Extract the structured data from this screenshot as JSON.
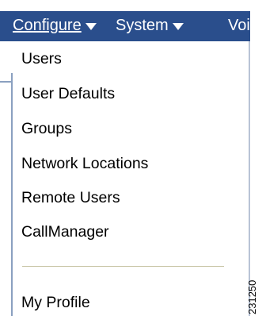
{
  "menubar": {
    "configure": "Configure",
    "system": "System",
    "voice": "Voi"
  },
  "configure_menu": {
    "items": [
      "Users",
      "User Defaults",
      "Groups",
      "Network Locations",
      "Remote Users",
      "CallManager",
      "My Profile"
    ]
  },
  "figure_id": "231250",
  "colors": {
    "menubar_bg": "#2a4e8c",
    "menubar_text": "#ffffff",
    "separator": "#c9c6a7"
  },
  "icons": {
    "menu_caret": "chevron-down-icon"
  }
}
